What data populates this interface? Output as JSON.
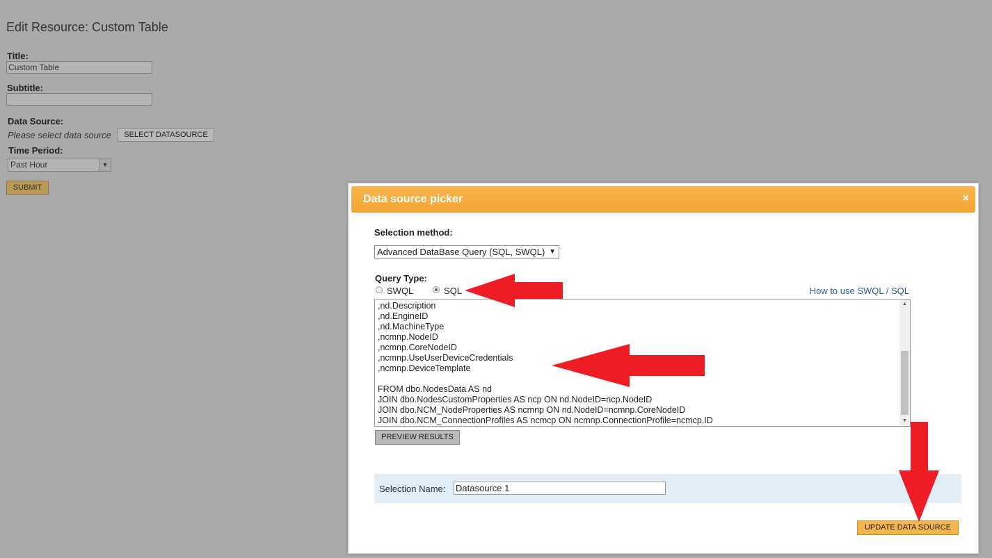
{
  "page": {
    "title": "Edit Resource: Custom Table",
    "title_label": "Title:",
    "title_value": "Custom Table",
    "subtitle_label": "Subtitle:",
    "subtitle_value": "",
    "datasource_label": "Data Source:",
    "datasource_hint": "Please select data source",
    "select_datasource_button": "SELECT DATASOURCE",
    "time_period_label": "Time Period:",
    "time_period_value": "Past Hour",
    "submit_button": "SUBMIT"
  },
  "modal": {
    "title": "Data source picker",
    "close": "×",
    "selection_method_label": "Selection method:",
    "selection_method_value": "Advanced DataBase Query (SQL, SWQL)",
    "query_type_label": "Query Type:",
    "radio_swql": "SWQL",
    "radio_sql": "SQL",
    "selected_query_type": "SQL",
    "help_link": "How to use SWQL / SQL",
    "query_lines": [
      ",nd.Description",
      ",nd.EngineID",
      ",nd.MachineType",
      ",ncmnp.NodeID",
      ",ncmnp.CoreNodeID",
      ",ncmnp.UseUserDeviceCredentials",
      ",ncmnp.DeviceTemplate",
      "",
      "FROM dbo.NodesData AS nd",
      "JOIN dbo.NodesCustomProperties AS ncp ON nd.NodeID=ncp.NodeID",
      "JOIN dbo.NCM_NodeProperties AS ncmnp ON nd.NodeID=ncmnp.CoreNodeID",
      "JOIN dbo.NCM_ConnectionProfiles AS ncmcp ON ncmnp.ConnectionProfile=ncmcp.ID"
    ],
    "preview_button": "PREVIEW RESULTS",
    "selection_name_label": "Selection Name:",
    "selection_name_value": "Datasource 1",
    "update_button": "UPDATE DATA SOURCE"
  },
  "colors": {
    "overlay": "#aaaaaa",
    "modal_header": "#f4a534",
    "accent_button": "#f4b54f",
    "annotation_arrow": "#ee1c25",
    "link": "#2a5d9f"
  }
}
